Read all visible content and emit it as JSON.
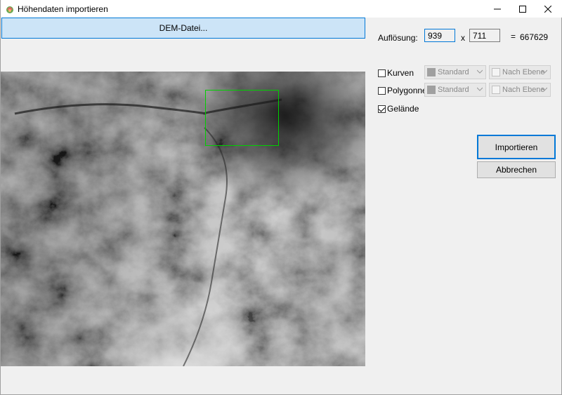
{
  "window": {
    "title": "Höhendaten importieren",
    "controls": {
      "minimize": "minimize-icon",
      "maximize": "maximize-icon",
      "close": "close-icon"
    }
  },
  "dem_button": {
    "label": "DEM-Datei..."
  },
  "resolution": {
    "label": "Auflösung:",
    "width": "939",
    "x_sep": "x",
    "height": "711",
    "eq_sep": "=",
    "total": "667629"
  },
  "layers": [
    {
      "label": "Kurven",
      "checked": false,
      "style": "Standard",
      "layer": "Nach Ebene"
    },
    {
      "label": "Polygonnetz",
      "checked": false,
      "style": "Standard",
      "layer": "Nach Ebene"
    },
    {
      "label": "Gelände",
      "checked": true
    }
  ],
  "buttons": {
    "import": "Importieren",
    "cancel": "Abbrechen"
  },
  "colors": {
    "accent": "#0078d7",
    "selection": "#00d000",
    "button_face": "#e1e1e1"
  }
}
